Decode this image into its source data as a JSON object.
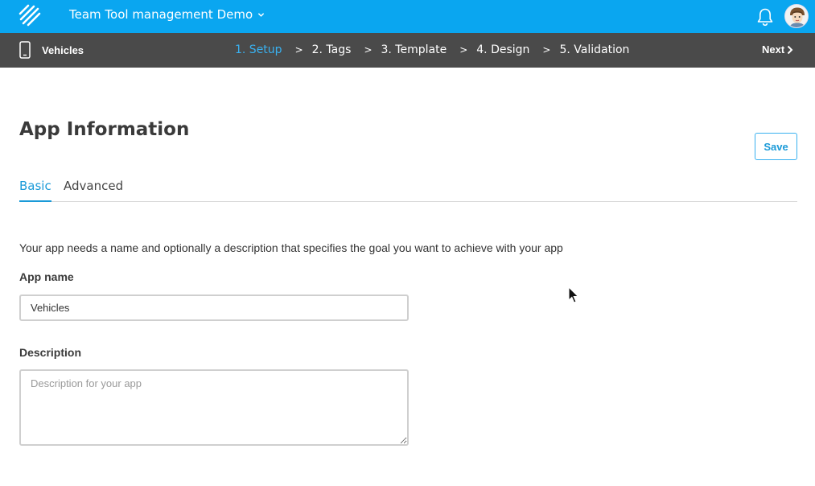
{
  "topbar": {
    "team_name": "Team Tool management Demo",
    "colors": {
      "background": "#0aa6f0"
    },
    "icons": [
      "logo-icon",
      "chevron-down-icon",
      "bell-icon",
      "avatar"
    ]
  },
  "wizard": {
    "app_name": "Vehicles",
    "steps": [
      {
        "label": "1. Setup",
        "active": true
      },
      {
        "label": "2. Tags",
        "active": false
      },
      {
        "label": "3. Template",
        "active": false
      },
      {
        "label": "4. Design",
        "active": false
      },
      {
        "label": "5. Validation",
        "active": false
      }
    ],
    "separator": ">",
    "next_label": "Next",
    "colors": {
      "background": "#4a4a4a",
      "active_step": "#39b1f0"
    }
  },
  "main": {
    "title": "App Information",
    "save_label": "Save",
    "tabs": [
      {
        "label": "Basic",
        "active": true
      },
      {
        "label": "Advanced",
        "active": false
      }
    ],
    "intro": "Your app needs a name and optionally a description that specifies the goal you want to achieve with your app",
    "app_name_label": "App name",
    "app_name_value": "Vehicles",
    "description_label": "Description",
    "description_placeholder": "Description for your app",
    "description_value": "",
    "colors": {
      "accent": "#1a9ad8"
    }
  }
}
